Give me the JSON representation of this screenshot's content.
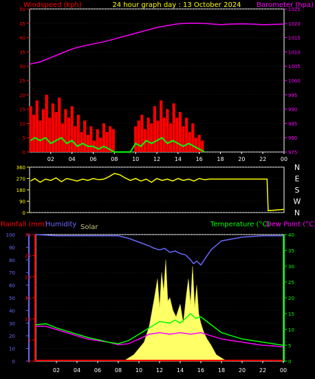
{
  "colors": {
    "background": "#000000",
    "axis": "#ffffff",
    "grid": "#3a3a3a",
    "wind_speed": "#ff0000",
    "wind_avg": "#00ff00",
    "wind_calm": "#ffffff",
    "pressure": "#ff00ff",
    "wind_dir": "#ffff00",
    "rain": "#ff0000",
    "humidity": "#6a6aff",
    "solar": "#ffff66",
    "temperature": "#00ff00",
    "dewpoint": "#ff00ff",
    "title": "#ffff00"
  },
  "header": {
    "windspeed_label": "Windspeed (kph)",
    "title": "24 hour graph day : 13 October 2024",
    "barometer_label": "Barometer (hpa)"
  },
  "chart_data": [
    {
      "id": "wind-pressure",
      "type": "line",
      "title": "24 hour graph day : 13 October 2024",
      "ylabel": "Windspeed (kph)",
      "y2label": "Barometer (hpa)",
      "x_ticks": [
        "02",
        "04",
        "06",
        "08",
        "10",
        "12",
        "14",
        "16",
        "18",
        "20",
        "22",
        "00"
      ],
      "ylim": [
        0,
        50
      ],
      "y_ticks": [
        "0",
        "5",
        "10",
        "15",
        "20",
        "25",
        "30",
        "35",
        "40",
        "45",
        "50"
      ],
      "y2lim": [
        975,
        1025
      ],
      "y2_ticks": [
        "975",
        "980",
        "985",
        "990",
        "995",
        "1000",
        "1005",
        "1010",
        "1015",
        "1020",
        "1025"
      ],
      "grid": false,
      "series": [
        {
          "name": "Barometer (hpa)",
          "x": [
            0,
            1,
            2,
            3,
            4,
            5,
            6,
            7,
            8,
            9,
            10,
            11,
            12,
            13,
            14,
            15,
            16,
            17,
            18,
            19,
            20,
            21,
            22,
            23,
            24
          ],
          "y": [
            1005.7,
            1006.5,
            1008,
            1009.5,
            1011,
            1012,
            1012.8,
            1013.5,
            1014.5,
            1015.5,
            1016.5,
            1017.5,
            1018.5,
            1019.2,
            1019.8,
            1020,
            1020,
            1019.8,
            1019.5,
            1019.7,
            1019.8,
            1019.7,
            1019.5,
            1019.6,
            1019.7
          ]
        },
        {
          "name": "Gust",
          "x": [
            0.1,
            0.4,
            0.7,
            1.0,
            1.3,
            1.6,
            1.9,
            2.2,
            2.5,
            2.8,
            3.1,
            3.4,
            3.7,
            4.0,
            4.3,
            4.6,
            4.9,
            5.2,
            5.5,
            5.8,
            6.1,
            6.4,
            6.7,
            7.0,
            7.3,
            7.6,
            7.9,
            8.2,
            8.5,
            8.8,
            9.1,
            9.4,
            9.7,
            10.0,
            10.3,
            10.6,
            10.9,
            11.2,
            11.5,
            11.8,
            12.1,
            12.4,
            12.7,
            13.0,
            13.3,
            13.6,
            13.9,
            14.2,
            14.5,
            14.8,
            15.1,
            15.4,
            15.7,
            16.0,
            16.3,
            16.6
          ],
          "y": [
            16,
            13,
            18,
            11,
            15,
            20,
            12,
            17,
            14,
            19,
            10,
            15,
            12,
            16,
            9,
            13,
            7,
            11,
            6,
            9,
            4,
            8,
            5,
            10,
            7,
            9,
            8,
            0,
            0,
            0,
            0,
            0,
            0,
            9,
            11,
            13,
            8,
            12,
            10,
            16,
            11,
            18,
            12,
            15,
            10,
            17,
            12,
            14,
            9,
            12,
            7,
            10,
            5,
            6,
            4,
            0
          ]
        },
        {
          "name": "Average",
          "x": [
            0.1,
            0.5,
            1.0,
            1.5,
            2.0,
            2.5,
            3.0,
            3.5,
            4.0,
            4.5,
            5.0,
            5.5,
            6.0,
            6.5,
            7.0,
            7.5,
            8.0,
            8.5,
            9.0,
            9.5,
            10.0,
            10.5,
            11.0,
            11.5,
            12.0,
            12.5,
            13.0,
            13.5,
            14.0,
            14.5,
            15.0,
            15.5,
            16.0,
            16.5
          ],
          "y": [
            4,
            5,
            4,
            5,
            3,
            4,
            5,
            3,
            4,
            2,
            3,
            2,
            2,
            1,
            2,
            1,
            0,
            0,
            0,
            0,
            3,
            2,
            4,
            3,
            4,
            5,
            3,
            4,
            3,
            2,
            3,
            2,
            1,
            0
          ]
        }
      ]
    },
    {
      "id": "wind-direction",
      "type": "line",
      "ylim": [
        0,
        360
      ],
      "y_ticks": [
        "0",
        "90",
        "180",
        "270",
        "360"
      ],
      "y2_ticks": [
        "N",
        "W",
        "S",
        "E",
        "N"
      ],
      "series": [
        {
          "name": "Direction",
          "x": [
            0.1,
            0.5,
            1.0,
            1.5,
            2.0,
            2.5,
            3.0,
            3.5,
            4.0,
            4.5,
            5.0,
            5.5,
            6.0,
            6.5,
            7.0,
            7.5,
            8.0,
            8.5,
            9.0,
            9.5,
            10.0,
            10.5,
            11.0,
            11.5,
            12.0,
            12.5,
            13.0,
            13.5,
            14.0,
            14.5,
            15.0,
            15.5,
            16.0,
            16.5,
            17.0,
            19.0,
            21.0,
            22.4,
            22.5,
            24.0
          ],
          "y": [
            250,
            270,
            240,
            265,
            255,
            275,
            245,
            270,
            260,
            250,
            265,
            255,
            270,
            260,
            265,
            285,
            310,
            300,
            275,
            255,
            270,
            250,
            265,
            240,
            270,
            255,
            265,
            250,
            270,
            255,
            265,
            250,
            270,
            260,
            265,
            265,
            265,
            265,
            15,
            25
          ]
        }
      ]
    },
    {
      "id": "temp-rain-humidity",
      "type": "line",
      "labels": {
        "rainfall": "Rainfall (mm)",
        "humidity": "Humidity",
        "solar": "Solar",
        "temperature": "Temperature (°C)",
        "dewpoint": "Dew Point (°C)"
      },
      "x_ticks": [
        "02",
        "04",
        "06",
        "08",
        "10",
        "12",
        "14",
        "16",
        "18",
        "20",
        "22",
        "00"
      ],
      "humidity_lim": [
        0,
        100
      ],
      "humidity_ticks": [
        "0",
        "10",
        "20",
        "30",
        "40",
        "50",
        "60",
        "70",
        "80",
        "90",
        "100"
      ],
      "rain_lim": [
        0,
        30
      ],
      "rain_ticks": [
        "0",
        "5",
        "10",
        "15",
        "20",
        "25",
        "30"
      ],
      "temp_lim": [
        0,
        40
      ],
      "temp_ticks": [
        "0",
        "5",
        "10",
        "15",
        "20",
        "25",
        "30",
        "35",
        "40"
      ],
      "series": [
        {
          "name": "Humidity",
          "x": [
            0,
            2,
            4,
            6,
            8,
            9,
            10,
            11,
            11.5,
            12,
            12.5,
            13,
            13.5,
            14,
            14.5,
            15,
            15.3,
            15.6,
            16,
            16.5,
            17,
            18,
            20,
            22,
            24
          ],
          "y": [
            100,
            99,
            99,
            99,
            99,
            97,
            94,
            91,
            89,
            88,
            89,
            86,
            87,
            85,
            84,
            80,
            77,
            79,
            76,
            82,
            88,
            95,
            98,
            99,
            99
          ]
        },
        {
          "name": "Temperature",
          "x": [
            0,
            1,
            2,
            3,
            4,
            5,
            6,
            7,
            8,
            9,
            10,
            11,
            12,
            13,
            13.5,
            14,
            14.5,
            15,
            15.5,
            16,
            17,
            18,
            19,
            20,
            21,
            22,
            23,
            24
          ],
          "y": [
            11.5,
            11.8,
            10.5,
            9.5,
            8.5,
            7.5,
            6.8,
            6,
            5.5,
            6.5,
            8.5,
            10.5,
            12.5,
            12,
            13,
            12,
            13.5,
            15,
            13.5,
            14,
            11.5,
            9,
            8,
            7,
            6.5,
            6,
            5.5,
            5
          ]
        },
        {
          "name": "Dew Point",
          "x": [
            0,
            1,
            2,
            3,
            4,
            5,
            6,
            7,
            8,
            9,
            10,
            11,
            12,
            13,
            14,
            15,
            16,
            17,
            18,
            19,
            20,
            21,
            22,
            23,
            24
          ],
          "y": [
            11,
            11,
            10,
            9,
            8,
            7,
            6.5,
            6,
            5.2,
            5.5,
            7,
            8.5,
            9,
            8.5,
            9,
            8.5,
            9,
            8,
            7,
            6.5,
            6,
            5.5,
            5,
            4.8,
            4.5
          ]
        },
        {
          "name": "Solar",
          "x": [
            8.5,
            9.5,
            10.5,
            11.0,
            11.5,
            11.8,
            12.0,
            12.2,
            12.4,
            12.6,
            12.8,
            13.0,
            13.3,
            13.6,
            14.0,
            14.3,
            14.6,
            14.8,
            15.0,
            15.2,
            15.4,
            15.6,
            15.8,
            16.0,
            16.3,
            16.6,
            17.0,
            17.5,
            18.5
          ],
          "y": [
            0,
            2,
            6,
            11,
            20,
            26,
            17,
            28,
            22,
            32,
            19,
            20,
            16,
            14,
            18,
            12,
            21,
            26,
            18,
            30,
            17,
            24,
            15,
            12,
            9,
            7,
            5,
            2,
            0
          ]
        }
      ]
    }
  ]
}
